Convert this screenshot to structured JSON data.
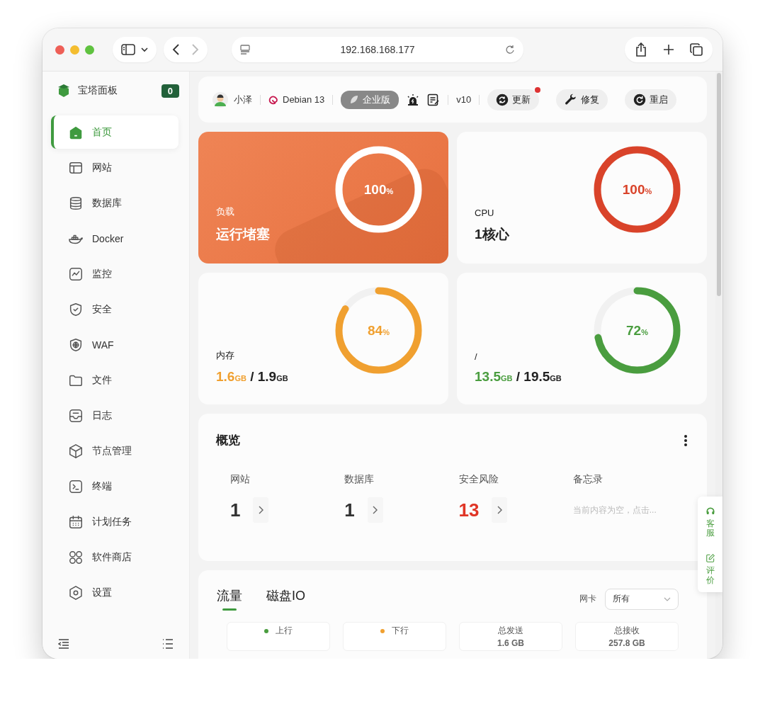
{
  "browser": {
    "url": "192.168.168.177"
  },
  "sidebar": {
    "title": "宝塔面板",
    "badge": "0",
    "items": [
      {
        "label": "首页",
        "selected": true
      },
      {
        "label": "网站",
        "selected": false
      },
      {
        "label": "数据库",
        "selected": false
      },
      {
        "label": "Docker",
        "selected": false
      },
      {
        "label": "监控",
        "selected": false
      },
      {
        "label": "安全",
        "selected": false
      },
      {
        "label": "WAF",
        "selected": false
      },
      {
        "label": "文件",
        "selected": false
      },
      {
        "label": "日志",
        "selected": false
      },
      {
        "label": "节点管理",
        "selected": false
      },
      {
        "label": "终端",
        "selected": false
      },
      {
        "label": "计划任务",
        "selected": false
      },
      {
        "label": "软件商店",
        "selected": false
      },
      {
        "label": "设置",
        "selected": false
      }
    ]
  },
  "header": {
    "user": "小泽",
    "os": "Debian 13",
    "edition": "企业版",
    "version": "v10",
    "buttons": [
      {
        "label": "更新",
        "notify": true
      },
      {
        "label": "修复",
        "notify": false
      },
      {
        "label": "重启",
        "notify": false
      }
    ]
  },
  "gauges": [
    {
      "kind": "text",
      "label": "负载",
      "value": "运行堵塞",
      "percent": "100",
      "percent_unit": "%",
      "level": 1,
      "highlighted": true
    },
    {
      "kind": "text",
      "label": "CPU",
      "value": "1核心",
      "percent": "100",
      "percent_unit": "%",
      "level": 1,
      "highlighted": false
    },
    {
      "kind": "usage",
      "label": "内存",
      "used": "1.6",
      "used_unit": "GB",
      "separator": "/",
      "total": "1.9",
      "total_unit": "GB",
      "percent": "84",
      "percent_unit": "%",
      "level": 0.84,
      "highlighted": false
    },
    {
      "kind": "usage",
      "label": "/",
      "used": "13.5",
      "used_unit": "GB",
      "separator": "/",
      "total": "19.5",
      "total_unit": "GB",
      "percent": "72",
      "percent_unit": "%",
      "level": 0.72,
      "highlighted": false
    }
  ],
  "overview": {
    "title": "概览",
    "items": [
      {
        "kind": "count",
        "label": "网站",
        "count": "1",
        "alert": false
      },
      {
        "kind": "count",
        "label": "数据库",
        "count": "1",
        "alert": false
      },
      {
        "kind": "count",
        "label": "安全风险",
        "count": "13",
        "alert": true
      },
      {
        "kind": "note",
        "label": "备忘录",
        "note": "当前内容为空，点击..."
      }
    ]
  },
  "traffic": {
    "tabs": [
      {
        "label": "流量",
        "selected": true
      },
      {
        "label": "磁盘IO",
        "selected": false
      }
    ],
    "nic_label": "网卡",
    "nic_value": "所有",
    "stats": [
      {
        "label": "上行",
        "color": "#4a9d3f"
      },
      {
        "label": "下行",
        "color": "#f0a030"
      },
      {
        "label": "总发送",
        "value": "1.6 GB"
      },
      {
        "label": "总接收",
        "value": "257.8 GB"
      }
    ]
  },
  "float_widget": [
    {
      "label": "客服"
    },
    {
      "label": "评价"
    }
  ]
}
